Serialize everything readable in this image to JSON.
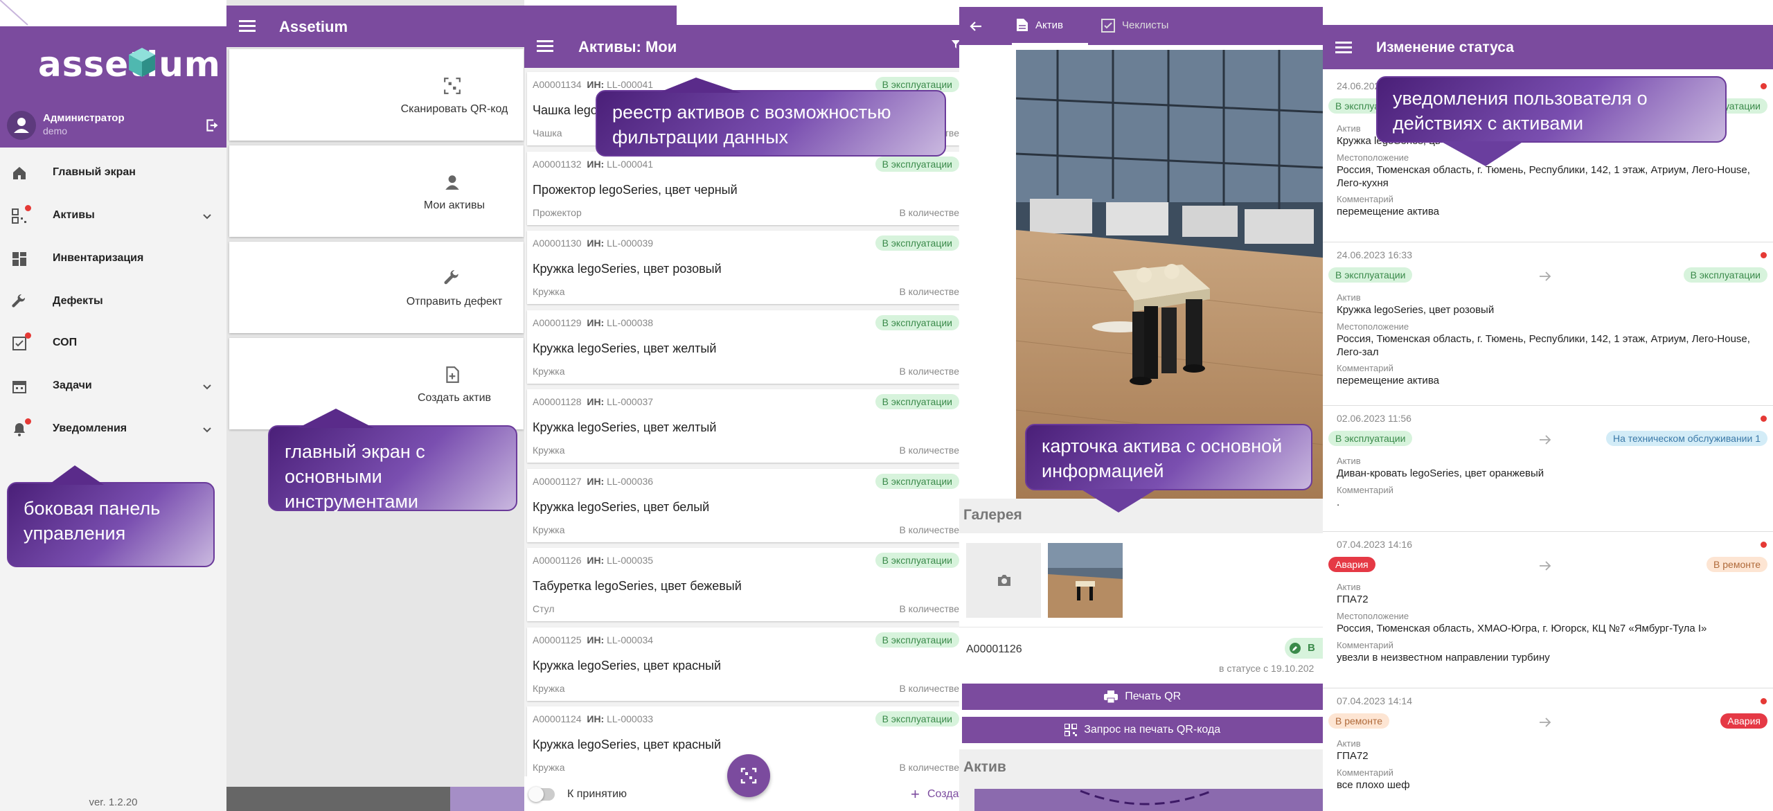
{
  "side": {
    "logo": "assetium",
    "user_name": "Администратор",
    "user_sub": "demo",
    "nav": [
      {
        "label": "Главный экран",
        "icon": "home-icon"
      },
      {
        "label": "Активы",
        "icon": "qr-assets-icon"
      },
      {
        "label": "Инвентаризация",
        "icon": "dashboard-icon"
      },
      {
        "label": "Дефекты",
        "icon": "wrench-icon"
      },
      {
        "label": "СОП",
        "icon": "checklist-icon"
      },
      {
        "label": "Задачи",
        "icon": "calendar-icon"
      },
      {
        "label": "Уведомления",
        "icon": "bell-icon"
      }
    ],
    "version": "ver. 1.2.20"
  },
  "callouts": {
    "side": "боковая панель управления",
    "main": "главный экран с основными инструментами",
    "list": "реестр активов с возможностью фильтрации данных",
    "card": "карточка актива с основной информацией",
    "status": "уведомления пользователя о действиях с активами"
  },
  "main": {
    "title": "Assetium",
    "tiles": [
      "Сканировать QR-код",
      "Мои активы",
      "Отправить дефект",
      "Создать актив"
    ]
  },
  "list": {
    "title": "Активы: Мои",
    "inv_prefix": "ИН:",
    "items": [
      {
        "id": "A00001134",
        "inv": "LL-000041",
        "name": "Чашка lego",
        "type": "Чашка",
        "status": "В эксплуатации",
        "qty": "В количестве"
      },
      {
        "id": "A00001132",
        "inv": "LL-000041",
        "name": "Прожектор legoSeries, цвет черный",
        "type": "Прожектор",
        "status": "В эксплуатации",
        "qty": "В количестве"
      },
      {
        "id": "A00001130",
        "inv": "LL-000039",
        "name": "Кружка legoSeries, цвет розовый",
        "type": "Кружка",
        "status": "В эксплуатации",
        "qty": "В количестве"
      },
      {
        "id": "A00001129",
        "inv": "LL-000038",
        "name": "Кружка legoSeries, цвет желтый",
        "type": "Кружка",
        "status": "В эксплуатации",
        "qty": "В количестве"
      },
      {
        "id": "A00001128",
        "inv": "LL-000037",
        "name": "Кружка legoSeries, цвет желтый",
        "type": "Кружка",
        "status": "В эксплуатации",
        "qty": "В количестве"
      },
      {
        "id": "A00001127",
        "inv": "LL-000036",
        "name": "Кружка legoSeries, цвет белый",
        "type": "Кружка",
        "status": "В эксплуатации",
        "qty": "В количестве"
      },
      {
        "id": "A00001126",
        "inv": "LL-000035",
        "name": "Табуретка legoSeries, цвет бежевый",
        "type": "Стул",
        "status": "В эксплуатации",
        "qty": "В количестве"
      },
      {
        "id": "A00001125",
        "inv": "LL-000034",
        "name": "Кружка legoSeries, цвет красный",
        "type": "Кружка",
        "status": "В эксплуатации",
        "qty": "В количестве"
      },
      {
        "id": "A00001124",
        "inv": "LL-000033",
        "name": "Кружка legoSeries, цвет красный",
        "type": "Кружка",
        "status": "В эксплуатации",
        "qty": "В количестве"
      }
    ],
    "toggle_label": "К принятию",
    "create_label": "Создать"
  },
  "card": {
    "tab_asset": "Актив",
    "tab_checklists": "Чеклисты",
    "gallery_title": "Галерея",
    "asset_id": "A00001126",
    "status_short": "В",
    "status_since": "в статусе с 19.10.202",
    "btn_print": "Печать QR",
    "btn_request": "Запрос на печать QR-кода",
    "section_asset": "Актив"
  },
  "status": {
    "title": "Изменение статуса",
    "labels": {
      "asset": "Актив",
      "location": "Местоположение",
      "comment": "Комментарий"
    },
    "items": [
      {
        "date": "24.06.2023",
        "from": "В эксплуатации",
        "to": "В эксплуатации",
        "asset": "Кружка legoSeries, цв",
        "location": "Россия, Тюменская область, г. Тюмень, Республики, 142, 1 этаж, Атриум, Лего-House, Лего-кухня",
        "comment": "перемещение актива"
      },
      {
        "date": "24.06.2023 16:33",
        "from": "В эксплуатации",
        "to": "В эксплуатации",
        "asset": "Кружка legoSeries, цвет розовый",
        "location": "Россия, Тюменская область, г. Тюмень, Республики, 142, 1 этаж, Атриум, Лего-House, Лего-зал",
        "comment": "перемещение актива"
      },
      {
        "date": "02.06.2023 11:56",
        "from": "В эксплуатации",
        "to": "На техническом обслуживании 1",
        "asset": "Диван-кровать legoSeries, цвет оранжевый",
        "location": "",
        "comment": "."
      },
      {
        "date": "07.04.2023 14:16",
        "from": "Авария",
        "to": "В ремонте",
        "asset": "ГПА72",
        "location": "Россия, Тюменская область, ХМАО-Югра, г. Югорск, КЦ №7 «Ямбург-Тула I»",
        "comment": "увезли в неизвестном направлении турбину"
      },
      {
        "date": "07.04.2023 14:14",
        "from": "В ремонте",
        "to": "Авария",
        "asset": "ГПА72",
        "location": "",
        "comment": "все плохо шеф"
      }
    ]
  },
  "colors": {
    "brand": "#7b4b9e",
    "ok": "#3a8a4a",
    "alarm": "#e53945",
    "repair": "#b06a3a",
    "service": "#3b79a8"
  }
}
